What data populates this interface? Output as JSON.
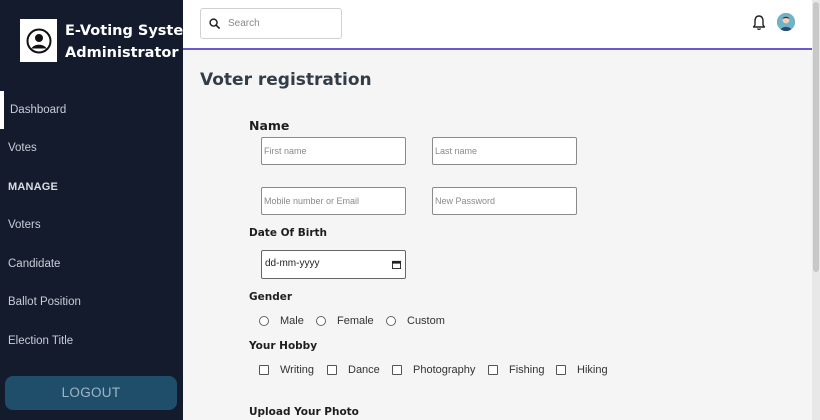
{
  "sidebar": {
    "brand_line1": "E-Voting System",
    "brand_line2": "Administrator",
    "items": [
      {
        "label": "Dashboard"
      },
      {
        "label": "Votes"
      },
      {
        "label": "MANAGE"
      },
      {
        "label": "Voters"
      },
      {
        "label": "Candidate"
      },
      {
        "label": "Ballot Position"
      },
      {
        "label": "Election Title"
      }
    ],
    "logout_label": "LOGOUT"
  },
  "header": {
    "search_placeholder": "Search",
    "accent_color": "#6a5acd"
  },
  "main": {
    "title": "Voter registration",
    "name_label": "Name",
    "first_name_placeholder": "First name",
    "last_name_placeholder": "Last name",
    "contact_placeholder": "Mobile number or Email",
    "password_placeholder": "New Password",
    "dob_label": "Date Of Birth",
    "dob_placeholder": "dd-mm-yyyy",
    "gender_label": "Gender",
    "gender_options": [
      "Male",
      "Female",
      "Custom"
    ],
    "hobby_label": "Your Hobby",
    "hobby_options": [
      "Writing",
      "Dance",
      "Photography",
      "Fishing",
      "Hiking"
    ],
    "photo_label": "Upload Your Photo"
  },
  "colors": {
    "sidebar_bg": "#141b2d",
    "logout_bg": "#1f4e6b",
    "header_border": "#6a5acd"
  }
}
